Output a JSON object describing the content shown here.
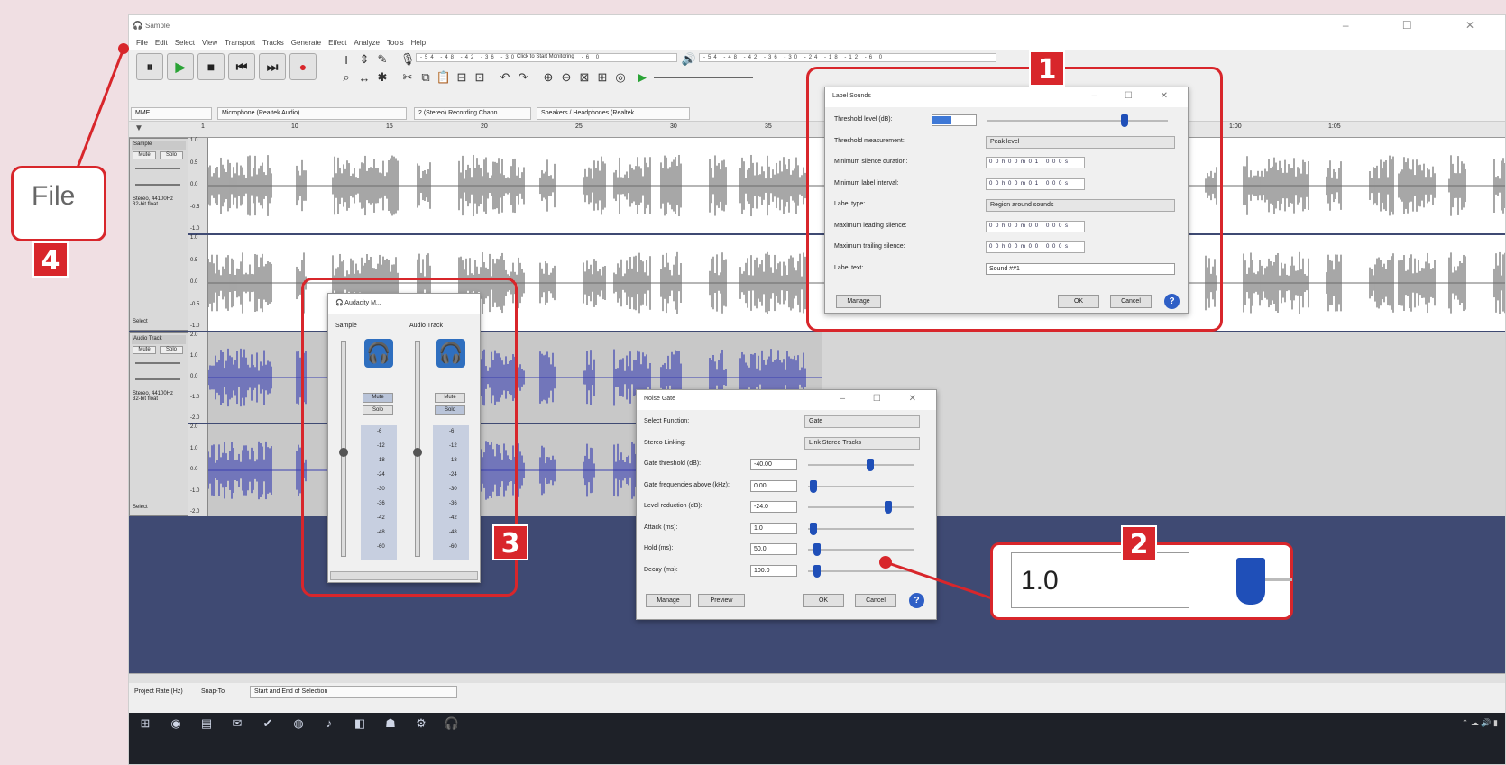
{
  "window": {
    "title": "Sample",
    "controls": "– ☐ ✕"
  },
  "menu": [
    "File",
    "Edit",
    "Select",
    "View",
    "Transport",
    "Tracks",
    "Generate",
    "Effect",
    "Analyze",
    "Tools",
    "Help"
  ],
  "toolbar": {
    "monitor_label": "Click to Start Monitoring",
    "meter_ticks": "-54 -48 -42 -36 -30 -24 -18 -12 -6 0"
  },
  "devices": {
    "host": "MME",
    "mic": "Microphone (Realtek Audio)",
    "channels": "2 (Stereo) Recording Chann",
    "speakers": "Speakers / Headphones (Realtek"
  },
  "ruler": [
    "1",
    "10",
    "15",
    "20",
    "25",
    "30",
    "35",
    "1:00",
    "1:05"
  ],
  "tracks": [
    {
      "name": "Sample",
      "info": "Stereo, 44100Hz\n32-bit float",
      "mute": "Mute",
      "solo": "Solo",
      "select": "Select",
      "scale": [
        "1.0",
        "0.5",
        "0.0",
        "-0.5",
        "-1.0"
      ]
    },
    {
      "name": "Audio Track",
      "info": "Stereo, 44100Hz\n32-bit float",
      "mute": "Mute",
      "solo": "Solo",
      "select": "Select",
      "scale": [
        "2.0",
        "1.0",
        "0.0",
        "-1.0",
        "-2.0"
      ]
    }
  ],
  "bottombar": {
    "rate_label": "Project Rate (Hz)",
    "snap_label": "Snap-To",
    "selection": "Start and End of Selection"
  },
  "label_sounds": {
    "title": "Label Sounds",
    "rows": [
      {
        "label": "Threshold level (dB):"
      },
      {
        "label": "Threshold measurement:",
        "value": "Peak level"
      },
      {
        "label": "Minimum silence duration:",
        "value": "0 0 h 0 0 m 0 1 . 0 0 0 s"
      },
      {
        "label": "Minimum label interval:",
        "value": "0 0 h 0 0 m 0 1 . 0 0 0 s"
      },
      {
        "label": "Label type:",
        "value": "Region around sounds"
      },
      {
        "label": "Maximum leading silence:",
        "value": "0 0 h 0 0 m 0 0 . 0 0 0 s"
      },
      {
        "label": "Maximum trailing silence:",
        "value": "0 0 h 0 0 m 0 0 . 0 0 0 s"
      },
      {
        "label": "Label text:",
        "value": "Sound ##1"
      }
    ],
    "manage": "Manage",
    "ok": "OK",
    "cancel": "Cancel",
    "threshold_level": 0.74
  },
  "noise_gate": {
    "title": "Noise Gate",
    "select_function_label": "Select Function:",
    "select_function": "Gate",
    "stereo_label": "Stereo Linking:",
    "stereo": "Link Stereo Tracks",
    "params": [
      {
        "label": "Gate threshold (dB):",
        "value": "-40.00",
        "level": 0.55
      },
      {
        "label": "Gate frequencies above (kHz):",
        "value": "0.00",
        "level": 0.02
      },
      {
        "label": "Level reduction (dB):",
        "value": "-24.0",
        "level": 0.72
      },
      {
        "label": "Attack (ms):",
        "value": "1.0",
        "level": 0.02
      },
      {
        "label": "Hold (ms):",
        "value": "50.0",
        "level": 0.05
      },
      {
        "label": "Decay (ms):",
        "value": "100.0",
        "level": 0.05
      }
    ],
    "manage": "Manage",
    "preview": "Preview",
    "ok": "OK",
    "cancel": "Cancel"
  },
  "mixer": {
    "title": "Audacity M...",
    "col1": "Sample",
    "col2": "Audio Track",
    "mute": "Mute",
    "solo": "Solo",
    "scale": [
      "-6",
      "-12",
      "-18",
      "-24",
      "-30",
      "-36",
      "-42",
      "-48",
      "-60"
    ]
  },
  "callouts": {
    "b1": "1",
    "b2": "2",
    "b3": "3",
    "b4": "4",
    "zoom_file": "File",
    "zoom_value": "1.0"
  },
  "colors": {
    "accent": "#d8262b",
    "slider": "#1f4fb8",
    "wave_sample": "#6c6c6c",
    "wave_audio": "#3a3fb0"
  }
}
